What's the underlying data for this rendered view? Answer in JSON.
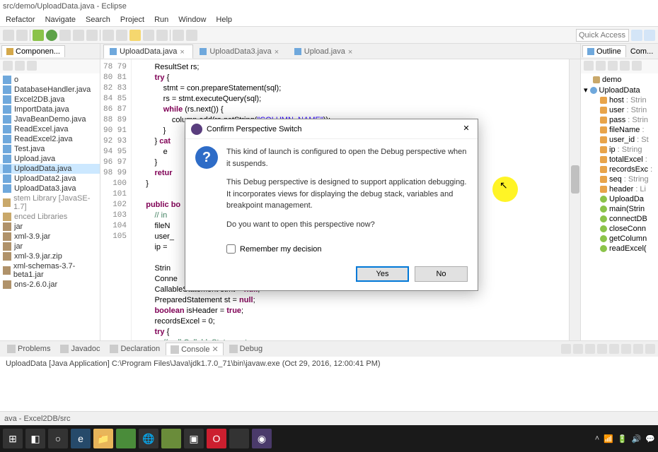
{
  "window": {
    "title": "src/demo/UploadData.java - Eclipse"
  },
  "menu": [
    "Refactor",
    "Navigate",
    "Search",
    "Project",
    "Run",
    "Window",
    "Help"
  ],
  "quickAccess": "Quick Access",
  "leftPanel": {
    "tab": "Componen...",
    "files": [
      "o",
      "DatabaseHandler.java",
      "Excel2DB.java",
      "ImportData.java",
      "JavaBeanDemo.java",
      "ReadExcel.java",
      "ReadExcel2.java",
      "Test.java",
      "Upload.java",
      "UploadData.java",
      "UploadData2.java",
      "UploadData3.java"
    ],
    "libs": [
      "stem Library [JavaSE-1.7]",
      "enced Libraries"
    ],
    "jars": [
      "jar",
      "xml-3.9.jar",
      "jar",
      "xml-3.9.jar.zip",
      "xml-schemas-3.7-beta1.jar",
      "ons-2.6.0.jar"
    ],
    "selectedIndex": 9
  },
  "editor": {
    "tabs": [
      "UploadData.java",
      "UploadData3.java",
      "Upload.java"
    ],
    "activeTab": 0,
    "lineStart": 78,
    "lineCount": 28
  },
  "outline": {
    "tabs": [
      "Outline",
      "Com..."
    ],
    "pkg": "demo",
    "class": "UploadData",
    "fields": [
      {
        "n": "host",
        "t": "Strin"
      },
      {
        "n": "user",
        "t": "Strin"
      },
      {
        "n": "pass",
        "t": "Strin"
      },
      {
        "n": "fileName",
        "t": ""
      },
      {
        "n": "user_id",
        "t": "St"
      },
      {
        "n": "ip",
        "t": "String"
      },
      {
        "n": "totalExcel",
        "t": ""
      },
      {
        "n": "recordsExc",
        "t": ""
      },
      {
        "n": "seq",
        "t": "String"
      },
      {
        "n": "header",
        "t": "Li"
      }
    ],
    "methods": [
      {
        "n": "UploadDa",
        "t": ""
      },
      {
        "n": "main(Strin",
        "t": ""
      },
      {
        "n": "connectDB",
        "t": ""
      },
      {
        "n": "closeConn",
        "t": ""
      },
      {
        "n": "getColumn",
        "t": ""
      },
      {
        "n": "readExcel(",
        "t": ""
      }
    ]
  },
  "bottomPanel": {
    "tabs": [
      "Problems",
      "Javadoc",
      "Declaration",
      "Console",
      "Debug"
    ],
    "activeTab": 3,
    "console": "UploadData [Java Application] C:\\Program Files\\Java\\jdk1.7.0_71\\bin\\javaw.exe (Oct 29, 2016, 12:00:41 PM)"
  },
  "statusbar": "ava - Excel2DB/src",
  "dialog": {
    "title": "Confirm Perspective Switch",
    "p1": "This kind of launch is configured to open the Debug perspective when it suspends.",
    "p2": "This Debug perspective is designed to support application debugging. It incorporates views for displaying the debug stack, variables and breakpoint management.",
    "p3": "Do you want to open this perspective now?",
    "remember": "Remember my decision",
    "yes": "Yes",
    "no": "No"
  }
}
